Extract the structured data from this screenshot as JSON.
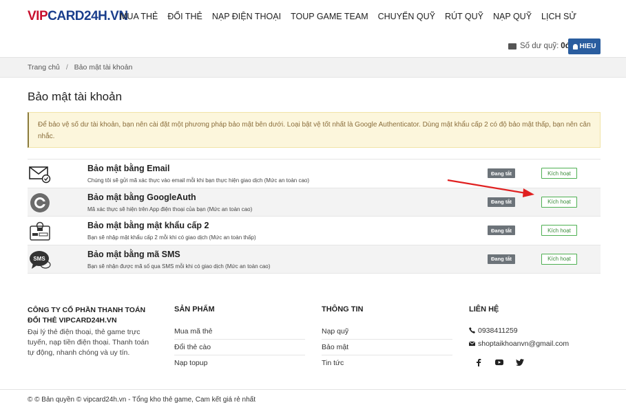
{
  "header": {
    "logo_vip": "VIP",
    "logo_rest": "CARD24H.VN",
    "nav": [
      "MUA THẺ",
      "ĐỔI THẺ",
      "NẠP ĐIỆN THOẠI",
      "TOUP GAME TEAM",
      "CHUYỂN QUỸ",
      "RÚT QUỸ",
      "NẠP QUỸ",
      "LỊCH SỬ"
    ],
    "balance_label": "Số dư quỹ:",
    "balance_value": "0đ",
    "user_label": "HIEU"
  },
  "breadcrumb": {
    "home": "Trang chủ",
    "separator": "/",
    "current": "Bảo mật tài khoản"
  },
  "page_title": "Bảo mật tài khoản",
  "alert": "Để bảo vệ số dư tài khoản, bạn nên cài đặt một phương pháp bảo mật bên dưới. Loại bật vệ tốt nhất là Google Authenticator. Dùng mật khẩu cấp 2 có độ bảo mật thấp, bạn nên cân nhắc.",
  "security_methods": [
    {
      "icon": "email-icon",
      "title": "Bảo mật bằng Email",
      "desc": "Chúng tôi sẽ gửi mã xác thực vào email mỗi khi bạn thực hiện giao dịch (Mức an toàn cao)",
      "status": "Đang tắt",
      "action": "Kích hoạt"
    },
    {
      "icon": "google-auth-icon",
      "title": "Bảo mật bằng GoogleAuth",
      "desc": "Mã xác thực sẽ hiện trên App điện thoại của bạn (Mức an toàn cao)",
      "status": "Đang tắt",
      "action": "Kích hoạt"
    },
    {
      "icon": "password-icon",
      "title": "Bảo mật bằng mật khẩu cấp 2",
      "desc": "Bạn sẽ nhập mật khẩu cấp 2 mỗi khi có giao dịch (Mức an toàn thấp)",
      "status": "Đang tắt",
      "action": "Kích hoạt"
    },
    {
      "icon": "sms-icon",
      "title": "Bảo mật bằng mã SMS",
      "desc": "Bạn sẽ nhận được mã số qua SMS mỗi khi có giao dịch (Mức an toàn cao)",
      "status": "Đang tắt",
      "action": "Kích hoạt"
    }
  ],
  "sms_icon_text": "SMS",
  "footer": {
    "company_name": "CÔNG TY CỔ PHẦN THANH TOÁN ĐỔI THẺ VIPCARD24H.VN",
    "company_desc": "Đại lý thẻ điện thoại, thẻ game trực tuyến, nạp tiền điện thoại. Thanh toán tự động, nhanh chóng và uy tín.",
    "products_title": "SẢN PHẨM",
    "products": [
      "Mua mã thẻ",
      "Đổi thẻ cào",
      "Nạp topup"
    ],
    "info_title": "THÔNG TIN",
    "info": [
      "Nạp quỹ",
      "Bảo mật",
      "Tin tức"
    ],
    "contact_title": "LIÊN HỆ",
    "phone": "0938411259",
    "email": "shoptaikhoanvn@gmail.com"
  },
  "copyright": "© © Bản quyền © vipcard24h.vn - Tổng kho thẻ game, Cam kết giá rẻ nhất",
  "colors": {
    "brand_red": "#c8102e",
    "brand_blue": "#1a3e8c",
    "button_blue": "#2a5d9f",
    "activate_green": "#4caf50",
    "arrow_red": "#e02020"
  }
}
